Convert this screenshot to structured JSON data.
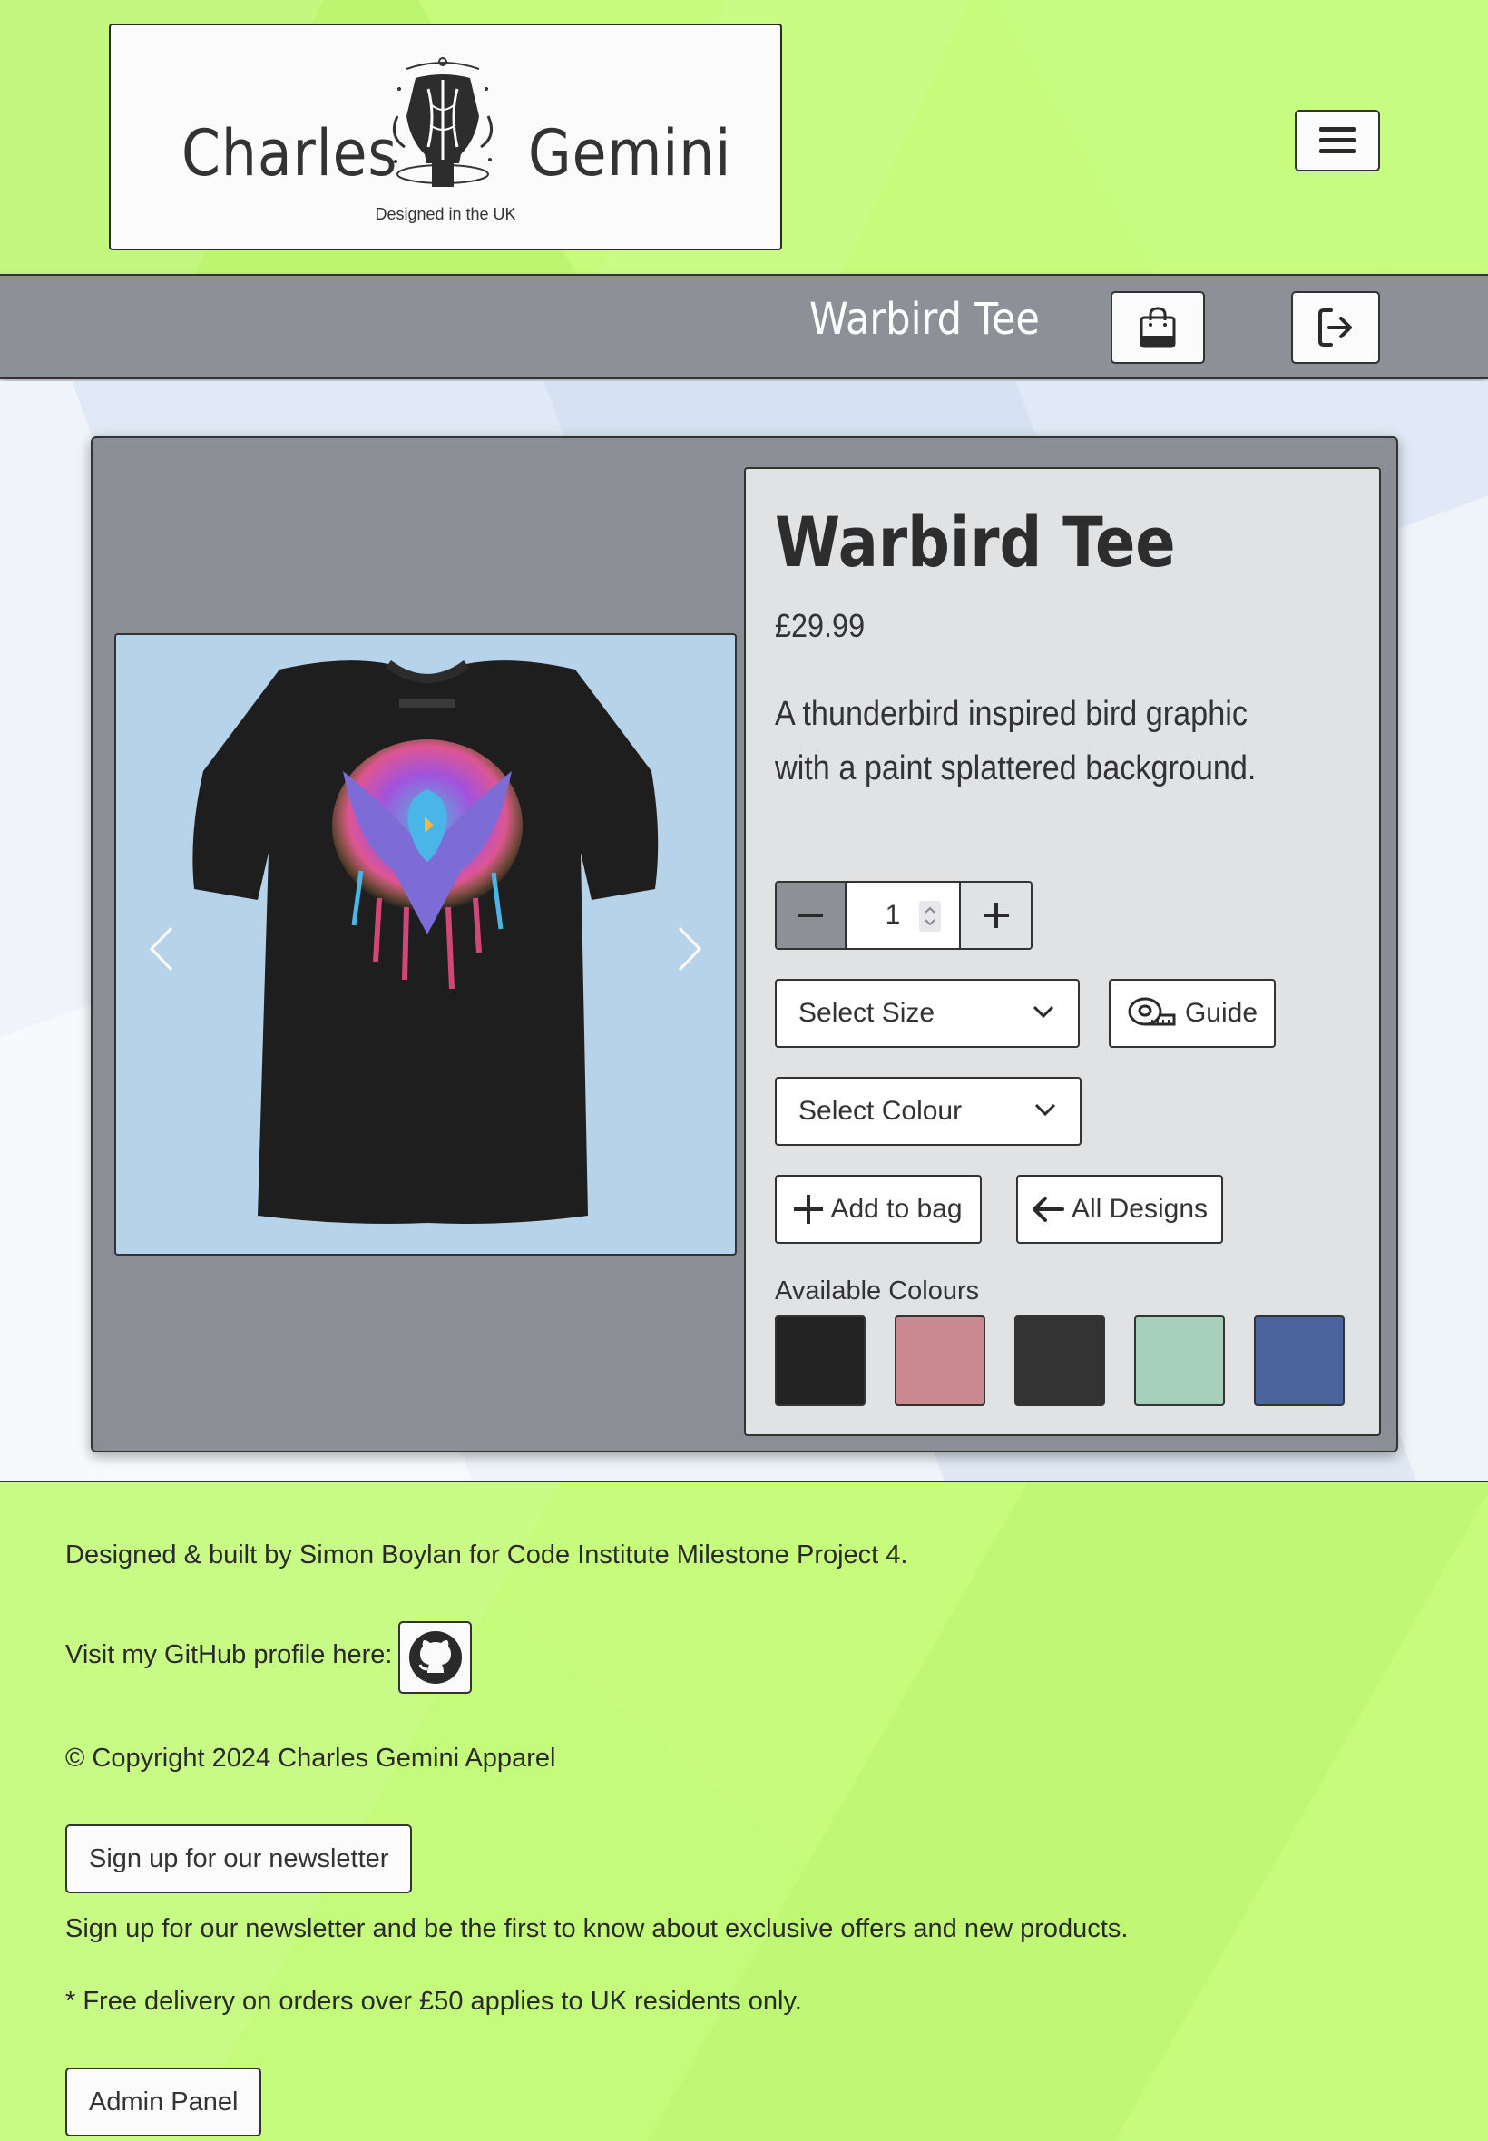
{
  "header": {
    "logo_word_left": "Charles",
    "logo_word_right": "Gemini",
    "logo_tagline": "Designed in the UK",
    "menu_icon": "hamburger-menu-icon"
  },
  "subnav": {
    "title": "Warbird Tee",
    "bag_icon": "shopping-bag-icon",
    "logout_icon": "logout-icon"
  },
  "product": {
    "name": "Warbird Tee",
    "price": "£29.99",
    "description": "A thunderbird inspired bird graphic with a paint splattered background.",
    "quantity": "1",
    "size_select": "Select Size",
    "guide_label": "Guide",
    "colour_select": "Select Colour",
    "add_to_bag_label": "Add to bag",
    "all_designs_label": "All Designs",
    "available_colours_label": "Available Colours",
    "colour_swatches": [
      "#232323",
      "#c98990",
      "#333333",
      "#a6d0b9",
      "#4a64a0"
    ]
  },
  "footer": {
    "credit": "Designed & built by Simon Boylan for Code Institute Milestone Project 4.",
    "github_label": "Visit my GitHub profile here:",
    "copyright": "© Copyright 2024 Charles Gemini Apparel",
    "newsletter_button": "Sign up for our newsletter",
    "newsletter_text": "Sign up for our newsletter and be the first to know about exclusive offers and new products.",
    "delivery_note": "* Free delivery on orders over £50 applies to UK residents only.",
    "admin_button": "Admin Panel"
  },
  "colors": {
    "header_green": "#c6fb7c",
    "subnav_grey": "#8d9096",
    "card_grey": "#8b8f95",
    "details_bg": "#e1e2e4",
    "carousel_bg": "#b7d3ea"
  }
}
